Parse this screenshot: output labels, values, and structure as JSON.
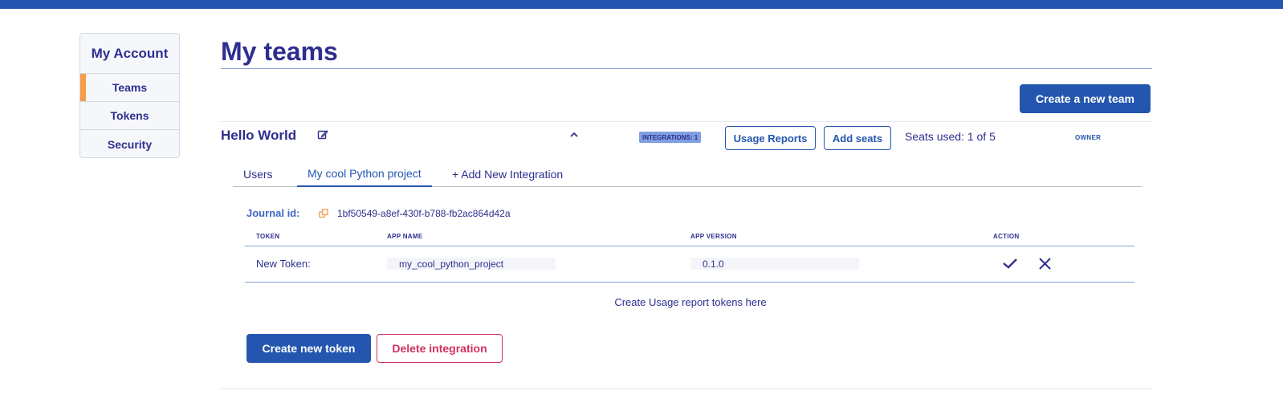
{
  "sidebar": {
    "title": "My Account",
    "items": [
      {
        "label": "Teams",
        "active": true
      },
      {
        "label": "Tokens",
        "active": false
      },
      {
        "label": "Security",
        "active": false
      }
    ]
  },
  "page": {
    "title": "My teams",
    "create_team_label": "Create a new team"
  },
  "team": {
    "name": "Hello World",
    "integrations_badge": "INTEGRATIONS: 1",
    "usage_reports_label": "Usage Reports",
    "add_seats_label": "Add seats",
    "seats_used": "Seats used: 1 of 5",
    "role": "OWNER"
  },
  "tabs": [
    {
      "label": "Users"
    },
    {
      "label": "My cool Python project",
      "active": true
    },
    {
      "label": "+ Add New Integration"
    }
  ],
  "integration": {
    "journal_label": "Journal id:",
    "journal_id": "1bf50549-a8ef-430f-b788-fb2ac864d42a",
    "table": {
      "headers": [
        "TOKEN",
        "APP NAME",
        "APP VERSION",
        "ACTION"
      ],
      "row": {
        "token": "New Token:",
        "app_name": "my_cool_python_project",
        "app_version": "0.1.0"
      }
    },
    "hint": "Create Usage report tokens here",
    "create_token_label": "Create new token",
    "delete_label": "Delete integration"
  },
  "colors": {
    "brand": "#2456b0",
    "text": "#2e2e8f",
    "accent": "#f59c4a",
    "danger": "#d2315f"
  }
}
